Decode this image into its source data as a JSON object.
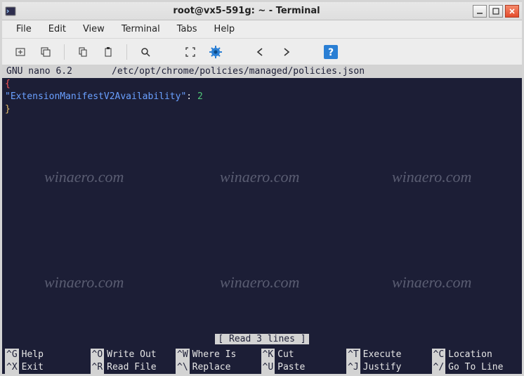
{
  "window": {
    "title": "root@vx5-591g: ~ - Terminal"
  },
  "menubar": [
    "File",
    "Edit",
    "View",
    "Terminal",
    "Tabs",
    "Help"
  ],
  "toolbar_icons": [
    "new-tab",
    "new-window",
    "copy",
    "paste",
    "search",
    "fullscreen",
    "settings",
    "back",
    "forward",
    "help"
  ],
  "nano": {
    "app": "GNU nano 6.2",
    "file": "/etc/opt/chrome/policies/managed/policies.json",
    "status": "[ Read 3 lines ]"
  },
  "content": {
    "line1": "{",
    "line2_key": "\"ExtensionManifestV2Availability\"",
    "line2_colon": ": ",
    "line2_val": "2",
    "line3": "}"
  },
  "shortcuts": {
    "row1": [
      {
        "key": "^G",
        "label": "Help"
      },
      {
        "key": "^O",
        "label": "Write Out"
      },
      {
        "key": "^W",
        "label": "Where Is"
      },
      {
        "key": "^K",
        "label": "Cut"
      },
      {
        "key": "^T",
        "label": "Execute"
      },
      {
        "key": "^C",
        "label": "Location"
      }
    ],
    "row2": [
      {
        "key": "^X",
        "label": "Exit"
      },
      {
        "key": "^R",
        "label": "Read File"
      },
      {
        "key": "^\\",
        "label": "Replace"
      },
      {
        "key": "^U",
        "label": "Paste"
      },
      {
        "key": "^J",
        "label": "Justify"
      },
      {
        "key": "^/",
        "label": "Go To Line"
      }
    ]
  },
  "watermark": "winaero.com"
}
